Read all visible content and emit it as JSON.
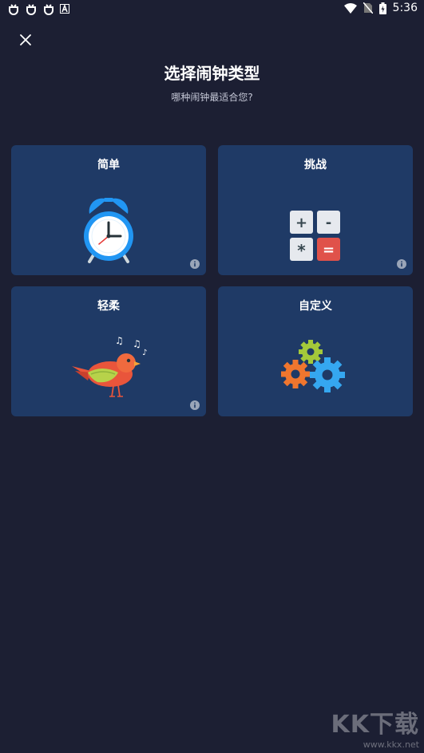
{
  "status_bar": {
    "time": "5:36",
    "left_icons": [
      "bug-icon",
      "bug-icon",
      "bug-icon",
      "a-box-icon"
    ],
    "right_icons": [
      "wifi-icon",
      "no-sim-icon",
      "battery-charging-icon"
    ]
  },
  "dialog": {
    "title": "选择闹钟类型",
    "subtitle": "哪种闹钟最适合您?",
    "close_icon": "close-icon"
  },
  "cards": [
    {
      "label": "简单",
      "icon": "alarm-clock-icon",
      "has_info": true
    },
    {
      "label": "挑战",
      "icon": "calculator-icon",
      "has_info": true,
      "calc_keys": [
        "+",
        "-",
        "*",
        "="
      ]
    },
    {
      "label": "轻柔",
      "icon": "singing-bird-icon",
      "has_info": true
    },
    {
      "label": "自定义",
      "icon": "gears-icon",
      "has_info": false
    }
  ],
  "watermark": {
    "logo": "KK下载",
    "url": "www.kkx.net"
  },
  "colors": {
    "background": "#1c1f33",
    "card": "#1f3a66",
    "clock_blue": "#2196f3",
    "calc_red": "#e0524a",
    "bird_red": "#e9553b",
    "gear_orange": "#f0762e",
    "gear_blue": "#35a7f0",
    "gear_green": "#a4c93a"
  }
}
